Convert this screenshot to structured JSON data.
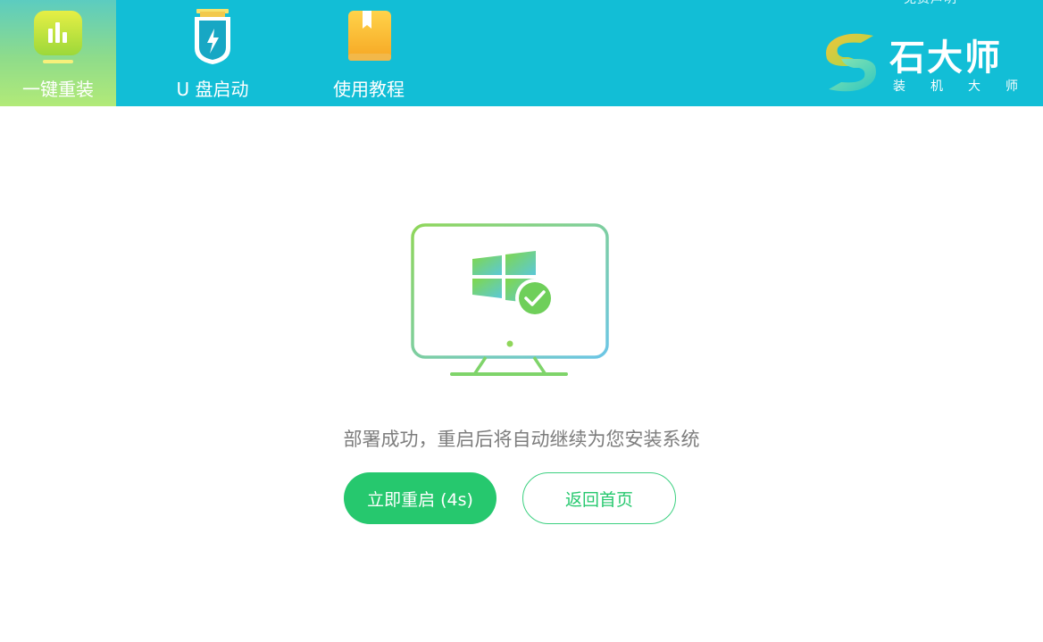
{
  "header": {
    "nav": [
      {
        "label": "一键重装",
        "icon": "chart-bars-icon"
      },
      {
        "label": "U 盘启动",
        "icon": "usb-drive-icon"
      },
      {
        "label": "使用教程",
        "icon": "book-icon"
      }
    ],
    "top_right_text": "免费声明",
    "brand": {
      "name": "石大师",
      "subtitle": [
        "装",
        "机",
        "大",
        "师"
      ]
    }
  },
  "main": {
    "illustration": "monitor-windows-check-icon",
    "message": "部署成功，重启后将自动继续为您安装系统",
    "restart_button": "立即重启 (4s)",
    "home_button": "返回首页"
  },
  "colors": {
    "header_bg": "#12bed6",
    "accent_green": "#26c86e",
    "message_gray": "#7d7d7d"
  }
}
